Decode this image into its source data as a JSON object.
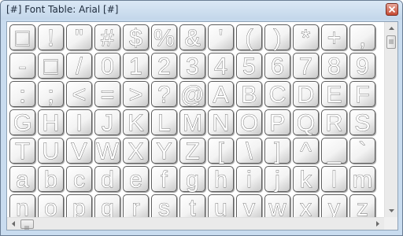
{
  "window": {
    "title": "[#] Font Table: Arial [#]"
  },
  "font_table": {
    "rows": [
      [
        "□",
        "!",
        "\"",
        "#",
        "$",
        "%",
        "&",
        "'",
        "(",
        ")",
        "*",
        "+",
        ","
      ],
      [
        "-",
        "□",
        "/",
        "0",
        "1",
        "2",
        "3",
        "4",
        "5",
        "6",
        "7",
        "8",
        "9"
      ],
      [
        ":",
        ";",
        "<",
        "=",
        ">",
        "?",
        "@",
        "A",
        "B",
        "C",
        "D",
        "E",
        "F"
      ],
      [
        "G",
        "H",
        "I",
        "J",
        "K",
        "L",
        "M",
        "N",
        "O",
        "P",
        "Q",
        "R",
        "S"
      ],
      [
        "T",
        "U",
        "V",
        "W",
        "X",
        "Y",
        "Z",
        "[",
        "\\",
        "]",
        "^",
        "_",
        "`"
      ],
      [
        "a",
        "b",
        "c",
        "d",
        "e",
        "f",
        "g",
        "h",
        "i",
        "j",
        "k",
        "l",
        "m"
      ],
      [
        "n",
        "o",
        "p",
        "q",
        "r",
        "s",
        "t",
        "u",
        "v",
        "w",
        "x",
        "y",
        "z"
      ]
    ]
  },
  "colors": {
    "frame": "#c9dcef",
    "tile_outline": "#5c5c5c",
    "close_button": "#c64a33"
  },
  "icons": {
    "close": "close-icon",
    "scroll_up": "arrow-up-icon",
    "scroll_down": "arrow-down-icon",
    "scroll_left": "arrow-left-icon",
    "scroll_right": "arrow-right-icon"
  },
  "scroll": {
    "vertical_position": 0.0,
    "horizontal_position": 0.0
  }
}
